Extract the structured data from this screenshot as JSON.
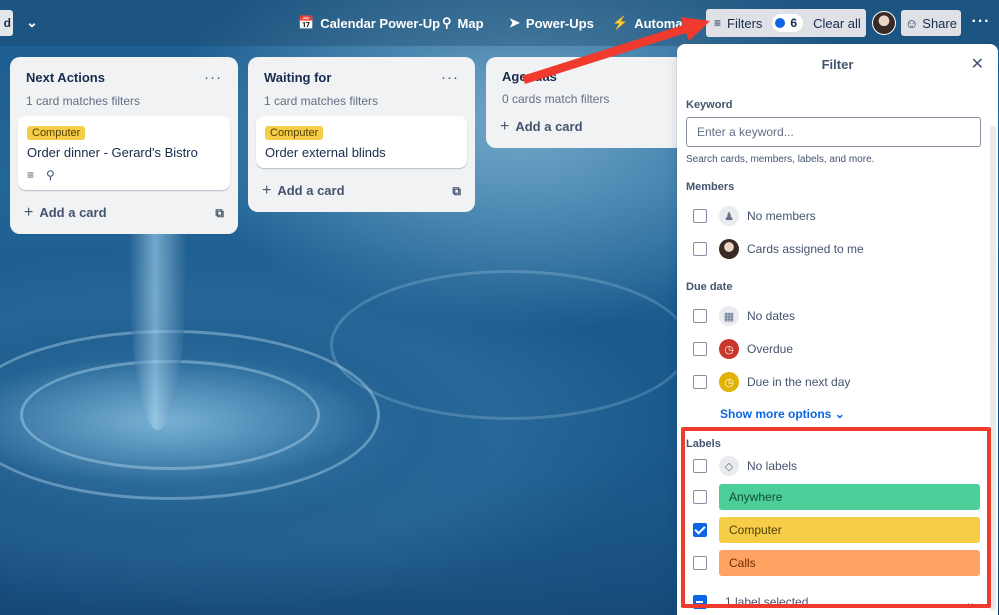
{
  "topbar": {
    "board_stub": "d",
    "calendar": "Calendar Power-Up",
    "map": "Map",
    "powerups": "Power-Ups",
    "automation": "Automat",
    "filters_label": "Filters",
    "filters_count": "6",
    "clear_all": "Clear all",
    "share": "Share"
  },
  "lists": [
    {
      "title": "Next Actions",
      "matches": "1 card matches filters",
      "card": {
        "label": "Computer",
        "title": "Order dinner - Gerard's Bistro"
      },
      "add": "Add a card"
    },
    {
      "title": "Waiting for",
      "matches": "1 card matches filters",
      "card": {
        "label": "Computer",
        "title": "Order external blinds"
      },
      "add": "Add a card"
    },
    {
      "title": "Agendas",
      "matches": "0 cards match filters",
      "add": "Add a card"
    }
  ],
  "filter": {
    "title": "Filter",
    "keyword_label": "Keyword",
    "keyword_placeholder": "Enter a keyword...",
    "keyword_help": "Search cards, members, labels, and more.",
    "members_label": "Members",
    "members": [
      "No members",
      "Cards assigned to me"
    ],
    "due_label": "Due date",
    "due": [
      "No dates",
      "Overdue",
      "Due in the next day"
    ],
    "show_more": "Show more options",
    "labels_label": "Labels",
    "no_labels": "No labels",
    "labels": [
      {
        "name": "Anywhere",
        "color": "#4bce97",
        "checked": false
      },
      {
        "name": "Computer",
        "color": "#f5cd47",
        "checked": true
      },
      {
        "name": "Calls",
        "color": "#fea362",
        "checked": false
      }
    ],
    "label_selected": "1 label selected"
  },
  "colors": {
    "accent": "#0c66e4",
    "highlight": "#f03a2e"
  },
  "icons": [
    "chevron-down-icon",
    "calendar-icon",
    "map-pin-icon",
    "rocket-icon",
    "bolt-icon",
    "filter-icon",
    "share-icon",
    "close-icon",
    "description-icon",
    "location-icon",
    "template-icon",
    "person-icon",
    "clock-icon",
    "tag-icon"
  ]
}
